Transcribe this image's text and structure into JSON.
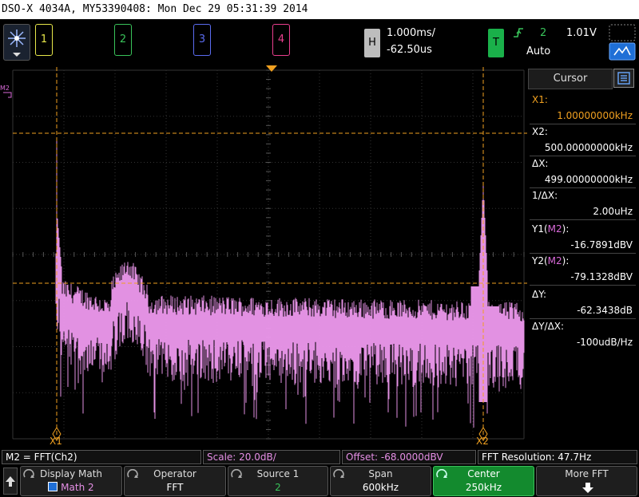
{
  "title": "DSO-X 4034A, MY53390408: Mon Dec 29 05:31:39 2014",
  "channels": [
    {
      "label": "1",
      "color": "#e8e84a"
    },
    {
      "label": "2",
      "color": "#39c35a"
    },
    {
      "label": "3",
      "color": "#5b6cf0"
    },
    {
      "label": "4",
      "color": "#ea3f8e"
    }
  ],
  "horizontal": {
    "button": "H",
    "scale": "1.000ms/",
    "delay": "-62.50us"
  },
  "trigger": {
    "button": "T",
    "source": "2",
    "level": "1.01V",
    "mode": "Auto"
  },
  "math_marker": "M2",
  "cursor_panel": {
    "header": "Cursor",
    "x1_label": "X1:",
    "x1_value": "1.00000000kHz",
    "x2_label": "X2:",
    "x2_value": "500.00000000kHz",
    "dx_label": "ΔX:",
    "dx_value": "499.00000000kHz",
    "inv_dx_label": "1/ΔX:",
    "inv_dx_value": "2.00uHz",
    "y1_label_pre": "Y1(",
    "y1_src": "M2",
    "y1_label_post": "):",
    "y1_value": "-16.7891dBV",
    "y2_label_pre": "Y2(",
    "y2_src": "M2",
    "y2_label_post": "):",
    "y2_value": "-79.1328dBV",
    "dy_label": "ΔY:",
    "dy_value": "-62.3438dB",
    "dydx_label": "ΔY/ΔX:",
    "dydx_value": "-100udB/Hz"
  },
  "cursor_tags": {
    "x1": "X1",
    "x2": "X2"
  },
  "status": {
    "math": "M2 = FFT(Ch2)",
    "scale": "Scale: 20.0dB/",
    "offset": "Offset: -68.0000dBV",
    "resolution": "FFT Resolution: 47.7Hz"
  },
  "softkeys": [
    {
      "line1": "Display Math",
      "line2": "Math 2"
    },
    {
      "line1": "Operator",
      "line2": "FFT"
    },
    {
      "line1": "Source 1",
      "line2": "2"
    },
    {
      "line1": "Span",
      "line2": "600kHz"
    },
    {
      "line1": "Center",
      "line2": "250kHz"
    },
    {
      "line1": "More FFT",
      "line2": ""
    }
  ],
  "colors": {
    "trace": "#ee99ee",
    "cursor": "#f0a020",
    "grid": "#333333",
    "math_label": "#d96ad9"
  },
  "icons": {
    "logo": "agilent-spark-icon",
    "menu": "menu-list-icon",
    "trigger_edge": "rising-edge-icon",
    "touch_toggle": "touch-toggle-icon",
    "home": "home-up-arrow-icon",
    "more": "down-arrow-icon"
  }
}
